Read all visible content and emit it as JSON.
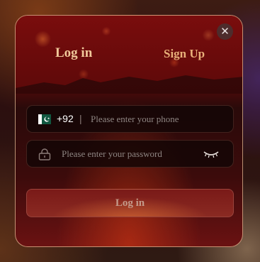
{
  "tabs": {
    "login_label": "Log in",
    "signup_label": "Sign Up"
  },
  "close": {
    "glyph": "✕"
  },
  "phone": {
    "country_flag": "pakistan-flag-icon",
    "country_code": "+92",
    "separator": "|",
    "placeholder": "Please enter your phone",
    "value": ""
  },
  "password": {
    "icon": "lock-icon",
    "placeholder": "Please enter your password",
    "value": "",
    "visibility_icon": "eye-closed-icon"
  },
  "submit": {
    "label": "Log in"
  },
  "colors": {
    "accent_text": "#f0c89a",
    "dialog_red": "#6e0a0a",
    "field_bg": "#14060 6"
  }
}
